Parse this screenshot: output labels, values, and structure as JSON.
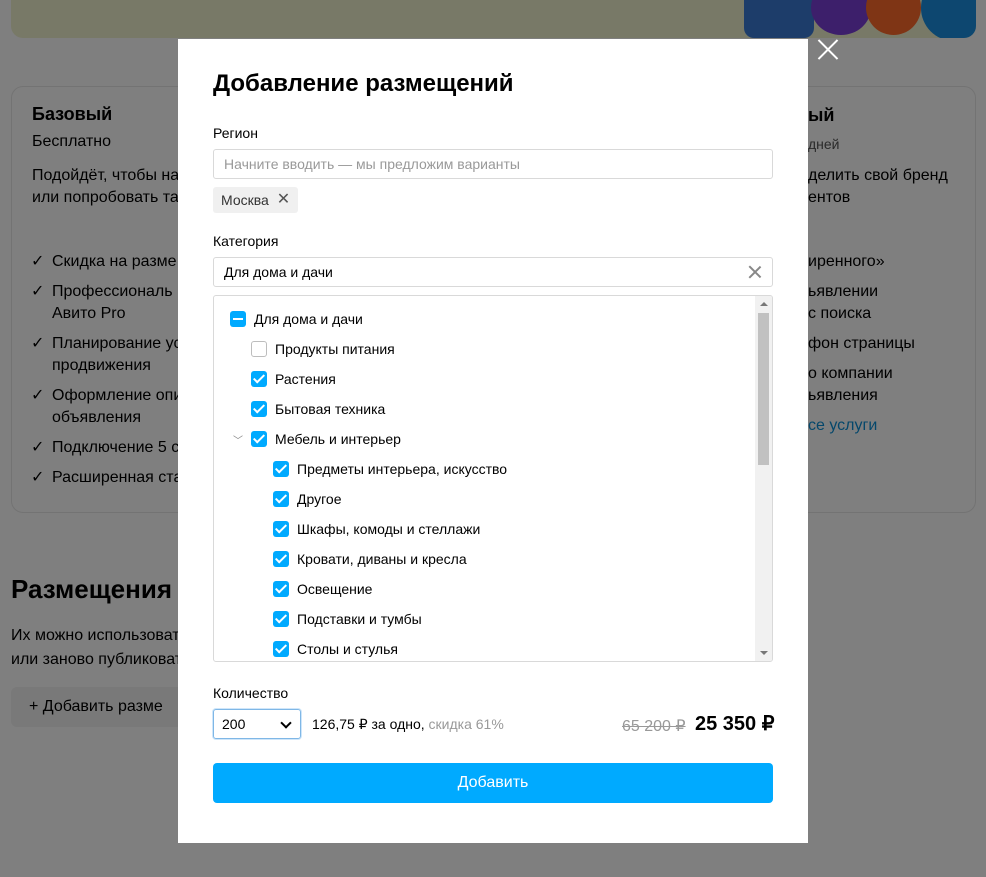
{
  "background": {
    "plan_left": {
      "title": "Базовый",
      "subtitle": "Бесплатно",
      "description_lines": [
        "Подойдёт, чтобы на",
        "или попробовать та"
      ],
      "features": [
        "Скидка на разме",
        "Профессиональ",
        "Авито Pro",
        "Планирование ус",
        "продвижения",
        "Оформление опи",
        "объявления",
        "Подключение 5 с",
        "Расширенная ста"
      ]
    },
    "plan_right": {
      "title": "ый",
      "subtitle": "дней",
      "description_lines": [
        "делить свой бренд",
        "ентов"
      ],
      "features": [
        "иренного»",
        "ьявлении",
        "с поиска",
        "фон страницы",
        "о компании",
        "ьявления"
      ],
      "link": "се услуги"
    },
    "section_title": "Размещения",
    "section_lines": [
      "Их можно использоват",
      "или заново публиковат"
    ],
    "add_button": "Добавить разме"
  },
  "modal": {
    "title": "Добавление размещений",
    "region": {
      "label": "Регион",
      "placeholder": "Начните вводить — мы предложим варианты",
      "chip": "Москва"
    },
    "category": {
      "label": "Категория",
      "value": "Для дома и дачи",
      "tree": [
        {
          "label": "Для дома и дачи",
          "state": "partial",
          "level": 0
        },
        {
          "label": "Продукты питания",
          "state": "off",
          "level": 1
        },
        {
          "label": "Растения",
          "state": "on",
          "level": 1
        },
        {
          "label": "Бытовая техника",
          "state": "on",
          "level": 1
        },
        {
          "label": "Мебель и интерьер",
          "state": "on",
          "level": 1,
          "expanded": true
        },
        {
          "label": "Предметы интерьера, искусство",
          "state": "on",
          "level": 2
        },
        {
          "label": "Другое",
          "state": "on",
          "level": 2
        },
        {
          "label": "Шкафы, комоды и стеллажи",
          "state": "on",
          "level": 2
        },
        {
          "label": "Кровати, диваны и кресла",
          "state": "on",
          "level": 2
        },
        {
          "label": "Освещение",
          "state": "on",
          "level": 2
        },
        {
          "label": "Подставки и тумбы",
          "state": "on",
          "level": 2
        },
        {
          "label": "Столы и стулья",
          "state": "on",
          "level": 2
        }
      ]
    },
    "quantity": {
      "label": "Количество",
      "value": "200",
      "per_one": "126,75 ₽ за одно,",
      "discount": "скидка 61%",
      "old_price": "65 200 ₽",
      "total": "25 350 ₽"
    },
    "add_button": "Добавить"
  },
  "colors": {
    "accent": "#00aaff",
    "banner": "#f0f3cf"
  }
}
